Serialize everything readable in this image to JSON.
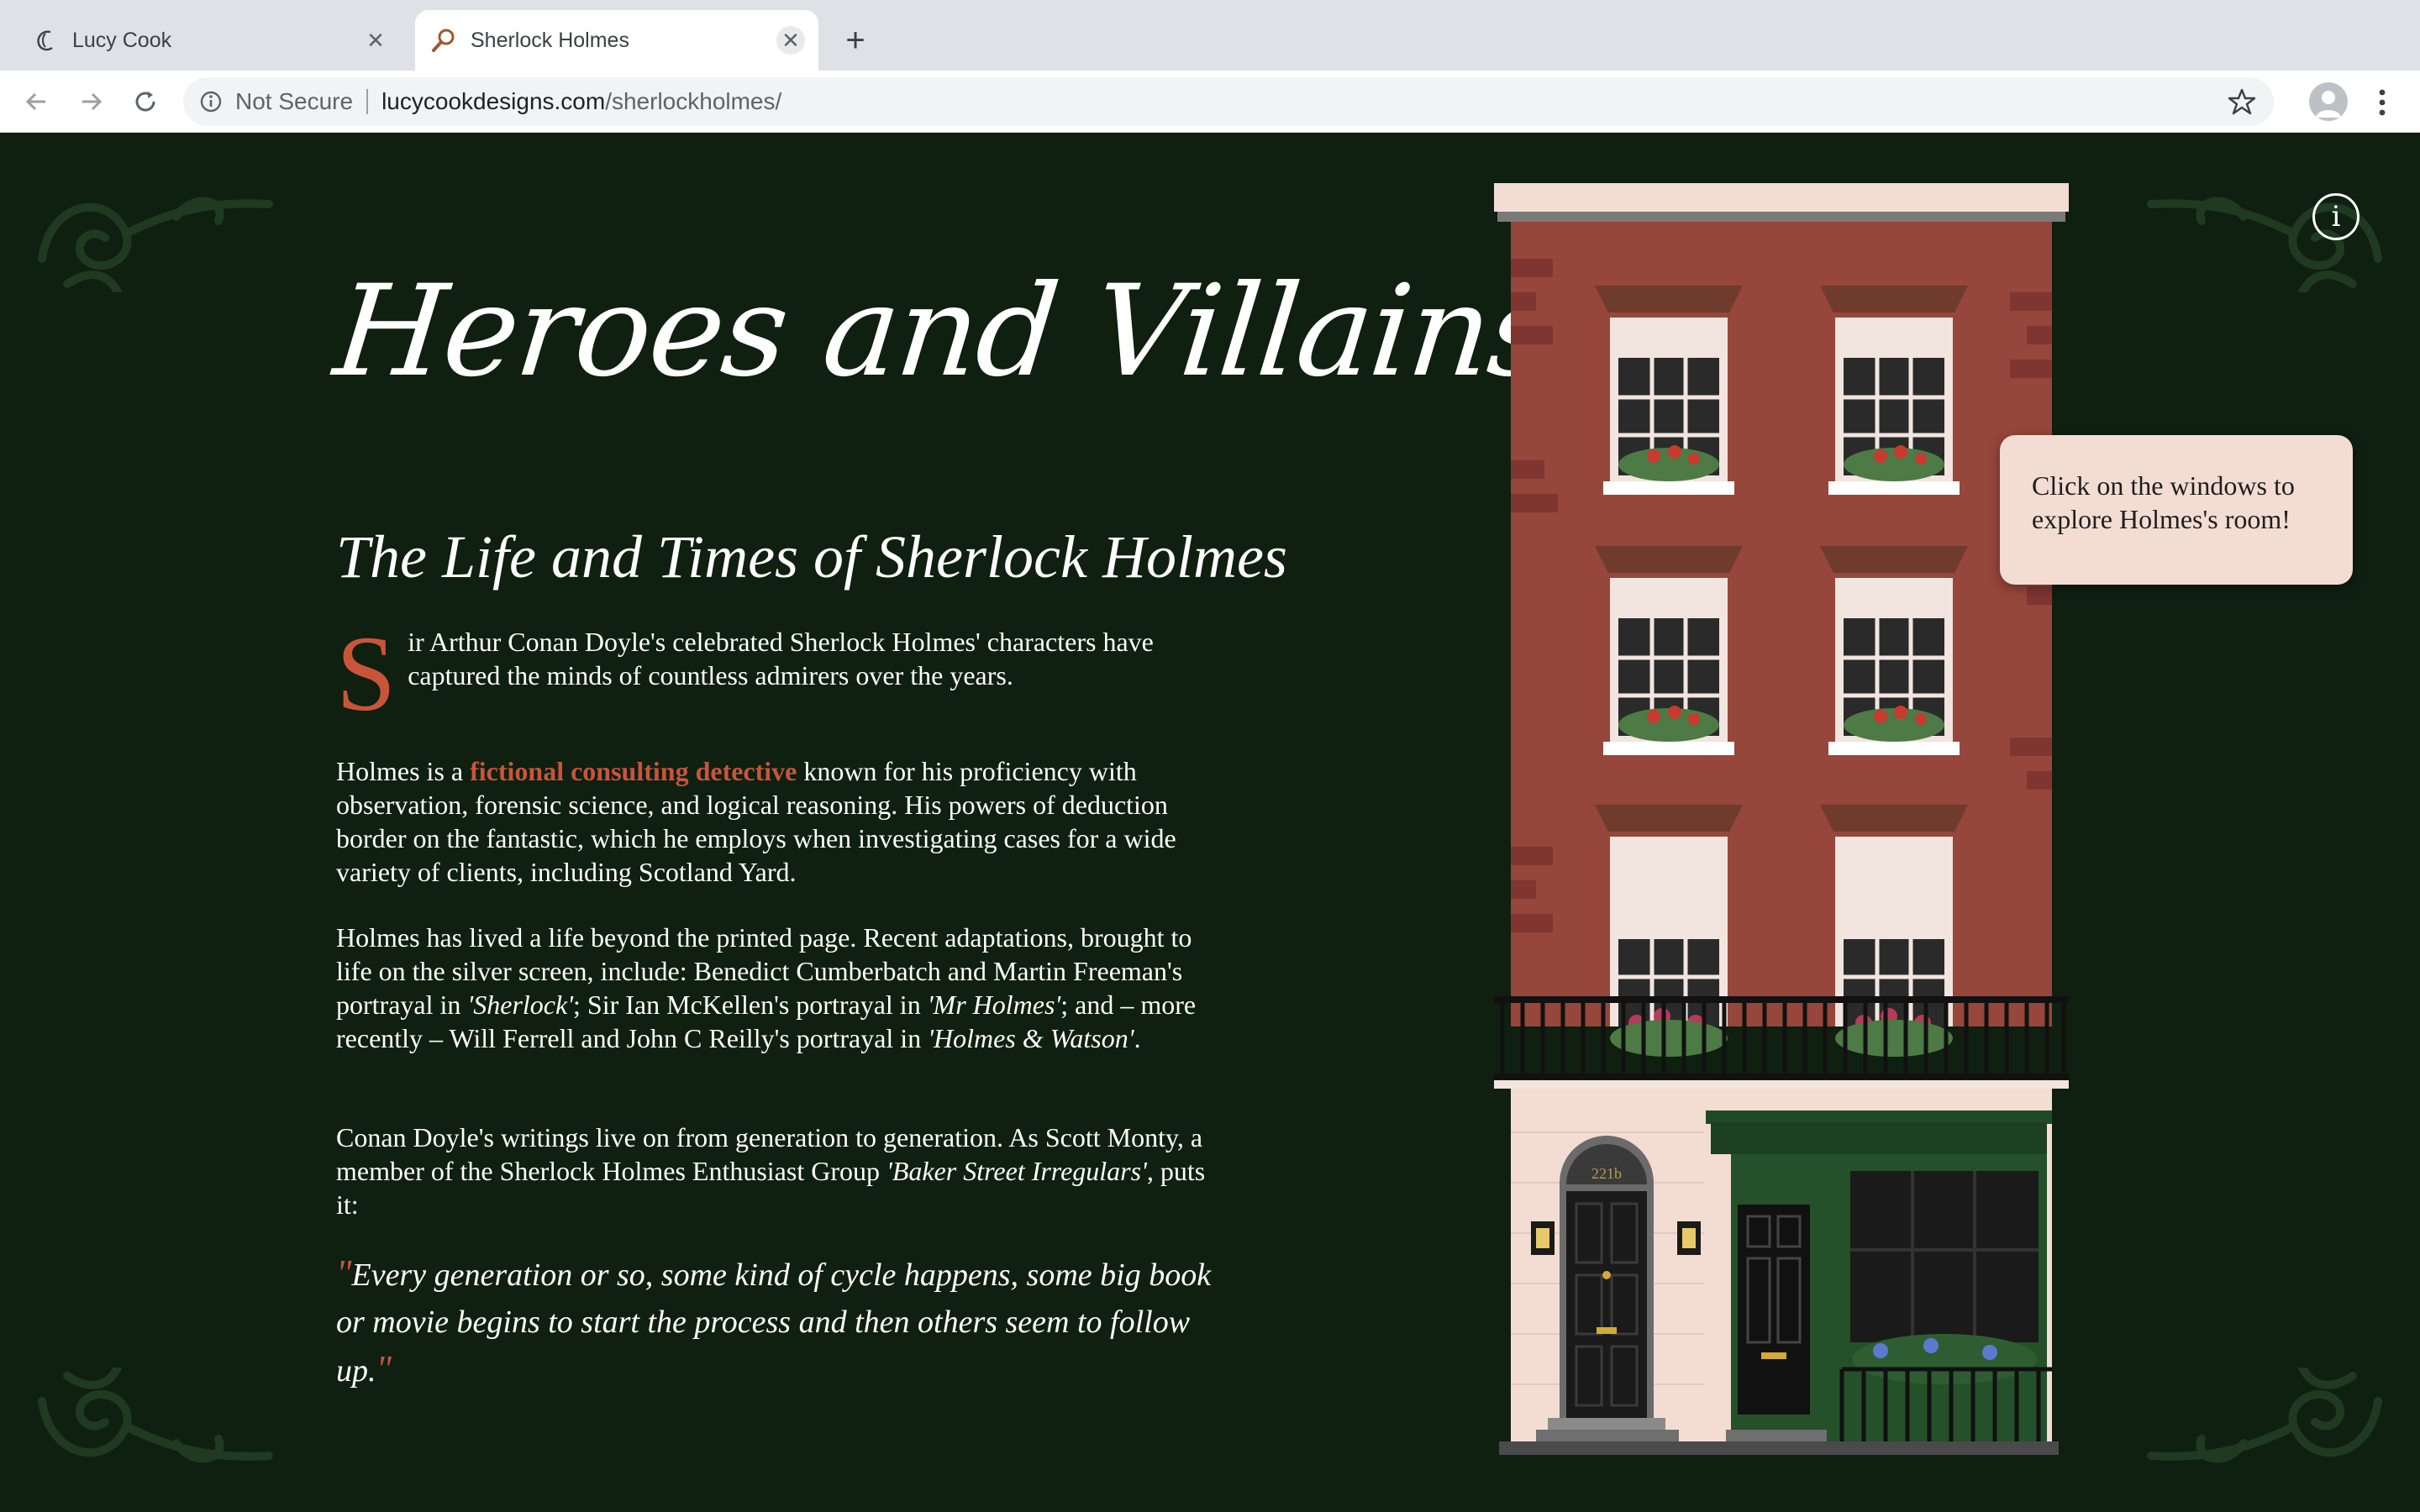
{
  "browser": {
    "tabs": [
      {
        "title": "Lucy Cook",
        "active": false
      },
      {
        "title": "Sherlock Holmes",
        "active": true
      }
    ],
    "new_tab_label": "+",
    "address": {
      "security": "Not Secure",
      "host": "lucycookdesigns.com",
      "path": "/sherlockholmes/"
    }
  },
  "page": {
    "heading": "Heroes and Villains",
    "subtitle": "The Life and Times of Sherlock Holmes",
    "intro": {
      "dropcap": "S",
      "text": "ir Arthur Conan Doyle's celebrated Sherlock Holmes' characters have captured the minds of countless admirers over the years."
    },
    "para2": {
      "before": "Holmes is a ",
      "link": "fictional consulting detective",
      "after": " known for his proficiency with observation, forensic science, and logical reasoning. His powers of deduction border on the fantastic, which he employs when investigating cases for a wide variety of clients, including Scotland Yard."
    },
    "para3": {
      "t1": "Holmes has lived a life beyond the printed page. Recent adaptations, brought to life on the silver screen, include: Benedict Cumberbatch and Martin Freeman's portrayal in ",
      "i1": "'Sherlock'",
      "t2": "; Sir Ian McKellen's portrayal in ",
      "i2": "'Mr Holmes'",
      "t3": "; and – more recently – Will Ferrell and John C Reilly's portrayal in ",
      "i3": "'Holmes & Watson'",
      "t4": "."
    },
    "para4": {
      "t1": "Conan Doyle's writings live on from generation to generation. As Scott Monty, a member of the Sherlock Holmes Enthusiast Group ",
      "i1": "'Baker Street Irregulars'",
      "t2": ", puts it:"
    },
    "quote": "Every generation or so, some kind of cycle happens, some big book or movie begins to start the process and then others seem to follow up.",
    "tooltip": "Click on the windows to explore Holmes's room!",
    "info_label": "i",
    "door_number": "221b"
  },
  "colors": {
    "background": "#0f1f10",
    "accent": "#c8553a",
    "brick": "#96463b",
    "tooltip_bg": "#f3ddd3"
  }
}
